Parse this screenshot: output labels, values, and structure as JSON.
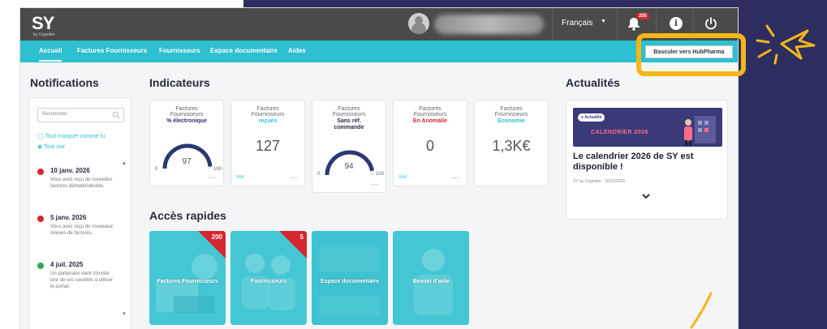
{
  "header": {
    "logo": "SY",
    "logo_sub": "by Cegedim",
    "language": "Français",
    "notification_count": "205"
  },
  "nav": {
    "items": [
      "Accueil",
      "Factures Fournisseurs",
      "Fournisseurs",
      "Espace documentaire",
      "Aides"
    ],
    "switch_button": "Basculer vers HubPharma"
  },
  "notifications": {
    "title": "Notifications",
    "search_placeholder": "Rechercher",
    "mark_all_read": "Tout marquer comme lu",
    "see_all": "Tout voir",
    "items": [
      {
        "date": "10 janv. 2026",
        "text": "Vous avez reçu de nouvelles factures dématérialisées.",
        "color": "#d6262f"
      },
      {
        "date": "5 janv. 2026",
        "text": "Vous avez reçu de nouveaux relevés de factures.",
        "color": "#d6262f"
      },
      {
        "date": "4 juil. 2025",
        "text": "Un partenaire vient d'inviter une de vos sociétés à utiliser le portail.",
        "color": "#2fa84f"
      }
    ]
  },
  "indicators": {
    "title": "Indicateurs",
    "cards": [
      {
        "l1": "Factures",
        "l2": "Fournisseurs",
        "l3": "% électronique",
        "l4": "",
        "accent": "#2a2a80",
        "gauge_value": "97",
        "gauge_min": "0",
        "gauge_max": "100",
        "value": "",
        "link": ""
      },
      {
        "l1": "Factures",
        "l2": "Fournisseurs",
        "l3": "reçues",
        "l4": "",
        "accent": "#2ebfd0",
        "gauge_value": "",
        "value": "127",
        "link": "Voir"
      },
      {
        "l1": "Factures",
        "l2": "Fournisseurs",
        "l3": "Sans réf.",
        "l4": "commande",
        "accent": "#2a2a40",
        "gauge_value": "94",
        "gauge_min": "0",
        "gauge_max": "100",
        "value": "",
        "link": ""
      },
      {
        "l1": "Factures",
        "l2": "Fournisseurs",
        "l3": "En Anomalie",
        "l4": "",
        "accent": "#d6262f",
        "gauge_value": "",
        "value": "0",
        "link": "Voir"
      },
      {
        "l1": "Factures",
        "l2": "Fournisseurs",
        "l3": "Economie",
        "l4": "",
        "accent": "#2ebfd0",
        "gauge_value": "",
        "value": "1,3K€",
        "link": ""
      }
    ]
  },
  "quick_access": {
    "title": "Accès rapides",
    "tiles": [
      {
        "label": "Factures Fournisseurs",
        "badge": "200"
      },
      {
        "label": "Fournisseurs",
        "badge": "5"
      },
      {
        "label": "Espace documentaire",
        "badge": ""
      },
      {
        "label": "Besoin d'aide",
        "badge": ""
      }
    ]
  },
  "news": {
    "title": "Actualités",
    "pill": "Actualité",
    "banner_text": "CALENDRIER 2026",
    "headline": "Le calendrier 2026 de SY est disponible !",
    "meta": "SY by Cegedim · 15/12/2025"
  },
  "colors": {
    "brand_teal": "#2ebfd0",
    "header_gray": "#4a4a4a",
    "highlight": "#f5b617",
    "frame_navy": "#2d2d60"
  }
}
